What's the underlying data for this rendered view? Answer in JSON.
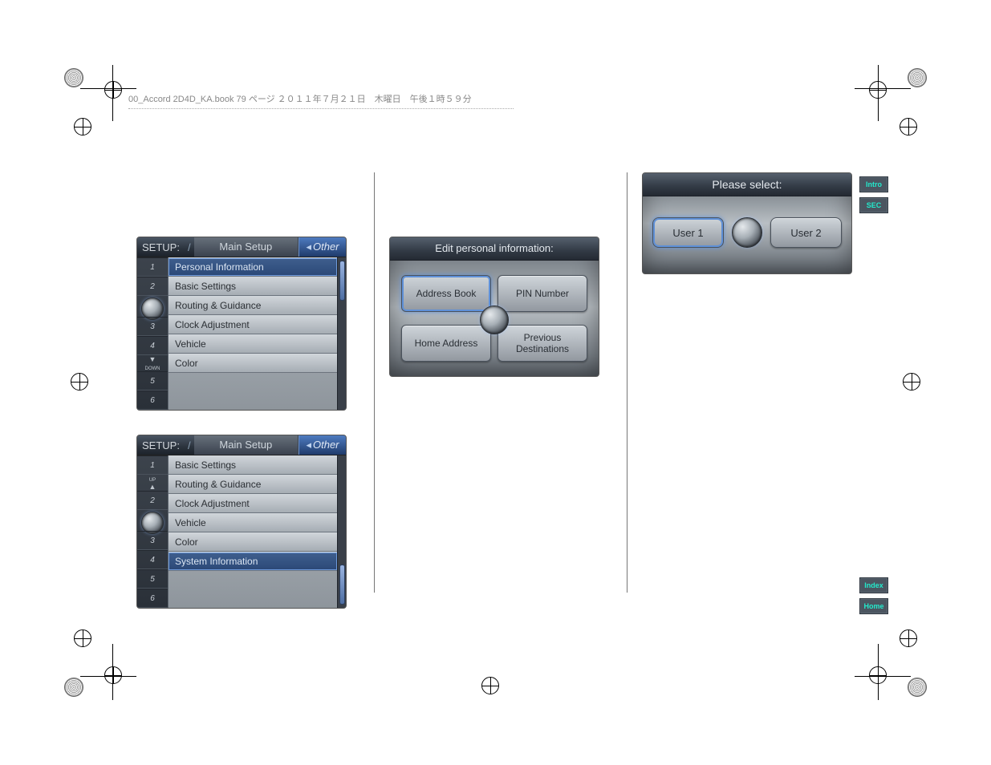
{
  "page_header": "00_Accord 2D4D_KA.book  79 ページ  ２０１１年７月２１日　木曜日　午後１時５９分",
  "setup_screen_1": {
    "setup_label": "SETUP:",
    "slash": "/",
    "tab_main": "Main Setup",
    "tab_other": "Other",
    "numbers": [
      "1",
      "2",
      "3",
      "4",
      "5",
      "6"
    ],
    "items": [
      "Personal Information",
      "Basic Settings",
      "Routing & Guidance",
      "Clock Adjustment",
      "Vehicle",
      "Color"
    ],
    "selected_index": 0,
    "down_label": "DOWN",
    "down_glyph": "▼"
  },
  "setup_screen_2": {
    "setup_label": "SETUP:",
    "slash": "/",
    "tab_main": "Main Setup",
    "tab_other": "Other",
    "numbers": [
      "1",
      "2",
      "3",
      "4",
      "5",
      "6"
    ],
    "items": [
      "Basic Settings",
      "Routing & Guidance",
      "Clock Adjustment",
      "Vehicle",
      "Color",
      "System Information"
    ],
    "selected_index": 5,
    "up_label": "UP",
    "up_glyph": "▲"
  },
  "edit_screen": {
    "title": "Edit personal information:",
    "top_left": "Address Book",
    "top_right": "PIN Number",
    "bottom_left": "Home Address",
    "bottom_right": "Previous\nDestinations",
    "selected": "top_left"
  },
  "user_screen": {
    "title": "Please select:",
    "left": "User 1",
    "right": "User 2",
    "selected": "left"
  },
  "side_tabs_top": [
    "Intro",
    "SEC"
  ],
  "side_tabs_bottom": [
    "Index",
    "Home"
  ]
}
